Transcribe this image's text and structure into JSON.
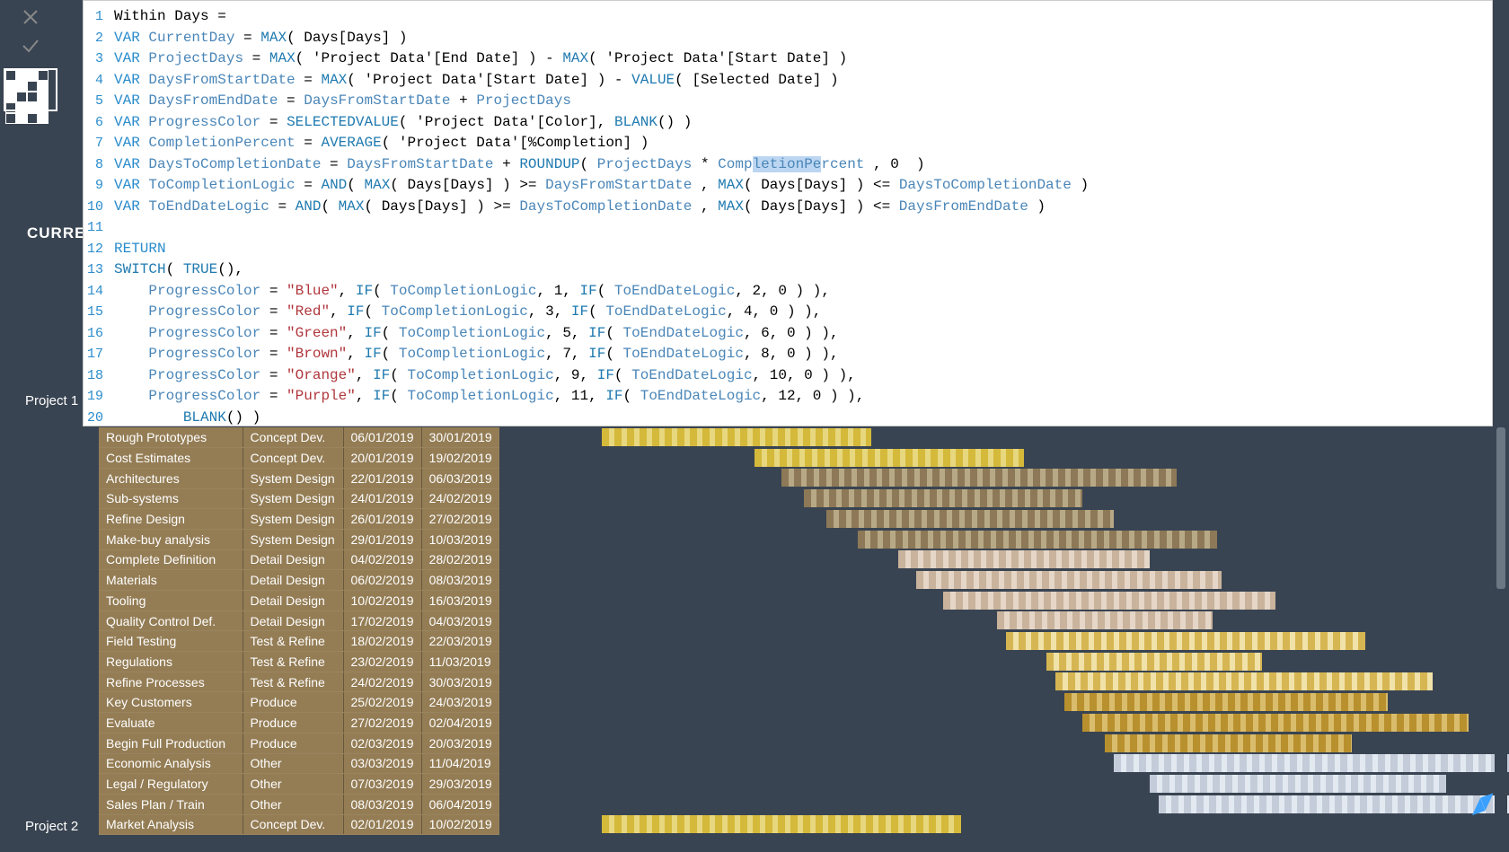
{
  "editor": {
    "truncated_label": "CURREN",
    "lines": [
      "Within Days =",
      "VAR CurrentDay = MAX( Days[Days] )",
      "VAR ProjectDays = MAX( 'Project Data'[End Date] ) - MAX( 'Project Data'[Start Date] )",
      "VAR DaysFromStartDate = MAX( 'Project Data'[Start Date] ) - VALUE( [Selected Date] )",
      "VAR DaysFromEndDate = DaysFromStartDate + ProjectDays",
      "VAR ProgressColor = SELECTEDVALUE( 'Project Data'[Color], BLANK() )",
      "VAR CompletionPercent = AVERAGE( 'Project Data'[%Completion] )",
      "VAR DaysToCompletionDate = DaysFromStartDate + ROUNDUP( ProjectDays * CompletionPercent , 0  )",
      "VAR ToCompletionLogic = AND( MAX( Days[Days] ) >= DaysFromStartDate , MAX( Days[Days] ) <= DaysToCompletionDate )",
      "VAR ToEndDateLogic = AND( MAX( Days[Days] ) >= DaysToCompletionDate , MAX( Days[Days] ) <= DaysFromEndDate )",
      "",
      "RETURN",
      "SWITCH( TRUE(),",
      "    ProgressColor = \"Blue\", IF( ToCompletionLogic, 1, IF( ToEndDateLogic, 2, 0 ) ),",
      "    ProgressColor = \"Red\", IF( ToCompletionLogic, 3, IF( ToEndDateLogic, 4, 0 ) ),",
      "    ProgressColor = \"Green\", IF( ToCompletionLogic, 5, IF( ToEndDateLogic, 6, 0 ) ),",
      "    ProgressColor = \"Brown\", IF( ToCompletionLogic, 7, IF( ToEndDateLogic, 8, 0 ) ),",
      "    ProgressColor = \"Orange\", IF( ToCompletionLogic, 9, IF( ToEndDateLogic, 10, 0 ) ),",
      "    ProgressColor = \"Purple\", IF( ToCompletionLogic, 11, IF( ToEndDateLogic, 12, 0 ) ),",
      "        BLANK() )"
    ],
    "selection": {
      "line": 8,
      "text": "letionPe"
    }
  },
  "projects": {
    "p1": "Project 1",
    "p2": "Project 2"
  },
  "rows": [
    {
      "task": "Rough Prototypes",
      "phase": "Concept Dev.",
      "start": "06/01/2019",
      "end": "30/01/2019",
      "barStart": 0,
      "barLen": 300,
      "c1": "#d4b93a",
      "c2": "#e7d77e"
    },
    {
      "task": "Cost Estimates",
      "phase": "Concept Dev.",
      "start": "20/01/2019",
      "end": "19/02/2019",
      "barStart": 170,
      "barLen": 300,
      "c1": "#d4b93a",
      "c2": "#e7d77e"
    },
    {
      "task": "Architectures",
      "phase": "System Design",
      "start": "22/01/2019",
      "end": "06/03/2019",
      "barStart": 200,
      "barLen": 440,
      "c1": "#8d7957",
      "c2": "#b8a986"
    },
    {
      "task": "Sub-systems",
      "phase": "System Design",
      "start": "24/01/2019",
      "end": "24/02/2019",
      "barStart": 225,
      "barLen": 310,
      "c1": "#8d7957",
      "c2": "#b8a986"
    },
    {
      "task": "Refine Design",
      "phase": "System Design",
      "start": "26/01/2019",
      "end": "27/02/2019",
      "barStart": 250,
      "barLen": 320,
      "c1": "#8d7957",
      "c2": "#b8a986"
    },
    {
      "task": "Make-buy analysis",
      "phase": "System Design",
      "start": "29/01/2019",
      "end": "10/03/2019",
      "barStart": 285,
      "barLen": 400,
      "c1": "#8d7957",
      "c2": "#b8a986"
    },
    {
      "task": "Complete Definition",
      "phase": "Detail Design",
      "start": "04/02/2019",
      "end": "28/02/2019",
      "barStart": 330,
      "barLen": 280,
      "c1": "#c9b39c",
      "c2": "#e5d6c7"
    },
    {
      "task": "Materials",
      "phase": "Detail Design",
      "start": "06/02/2019",
      "end": "08/03/2019",
      "barStart": 350,
      "barLen": 340,
      "c1": "#c9b39c",
      "c2": "#e5d6c7"
    },
    {
      "task": "Tooling",
      "phase": "Detail Design",
      "start": "10/02/2019",
      "end": "16/03/2019",
      "barStart": 380,
      "barLen": 370,
      "c1": "#c9b39c",
      "c2": "#e5d6c7"
    },
    {
      "task": "Quality Control Def.",
      "phase": "Detail Design",
      "start": "17/02/2019",
      "end": "04/03/2019",
      "barStart": 440,
      "barLen": 240,
      "c1": "#c9b39c",
      "c2": "#e5d6c7"
    },
    {
      "task": "Field Testing",
      "phase": "Test & Refine",
      "start": "18/02/2019",
      "end": "22/03/2019",
      "barStart": 450,
      "barLen": 400,
      "c1": "#d6b653",
      "c2": "#f0e2a8"
    },
    {
      "task": "Regulations",
      "phase": "Test & Refine",
      "start": "23/02/2019",
      "end": "11/03/2019",
      "barStart": 495,
      "barLen": 240,
      "c1": "#d6b653",
      "c2": "#f0e2a8"
    },
    {
      "task": "Refine Processes",
      "phase": "Test & Refine",
      "start": "24/02/2019",
      "end": "30/03/2019",
      "barStart": 505,
      "barLen": 420,
      "c1": "#d6b653",
      "c2": "#f0e2a8"
    },
    {
      "task": "Key Customers",
      "phase": "Produce",
      "start": "25/02/2019",
      "end": "24/03/2019",
      "barStart": 515,
      "barLen": 360,
      "c1": "#b9902e",
      "c2": "#d9bd6d"
    },
    {
      "task": "Evaluate",
      "phase": "Produce",
      "start": "27/02/2019",
      "end": "02/04/2019",
      "barStart": 535,
      "barLen": 430,
      "c1": "#b9902e",
      "c2": "#d9bd6d"
    },
    {
      "task": "Begin Full Production",
      "phase": "Produce",
      "start": "02/03/2019",
      "end": "20/03/2019",
      "barStart": 560,
      "barLen": 275,
      "c1": "#b9902e",
      "c2": "#d9bd6d"
    },
    {
      "task": "Economic Analysis",
      "phase": "Other",
      "start": "03/03/2019",
      "end": "11/04/2019",
      "barStart": 570,
      "barLen": 510,
      "c1": "#c3ccd8",
      "c2": "#e3e9f1"
    },
    {
      "task": "Legal / Regulatory",
      "phase": "Other",
      "start": "07/03/2019",
      "end": "29/03/2019",
      "barStart": 610,
      "barLen": 330,
      "c1": "#c3ccd8",
      "c2": "#e3e9f1"
    },
    {
      "task": "Sales Plan / Train",
      "phase": "Other",
      "start": "08/03/2019",
      "end": "06/04/2019",
      "barStart": 620,
      "barLen": 400,
      "c1": "#c3ccd8",
      "c2": "#e3e9f1"
    },
    {
      "task": "Market Analysis",
      "phase": "Concept Dev.",
      "start": "02/01/2019",
      "end": "10/02/2019",
      "barStart": 0,
      "barLen": 400,
      "c1": "#d4b93a",
      "c2": "#e7d77e"
    }
  ]
}
